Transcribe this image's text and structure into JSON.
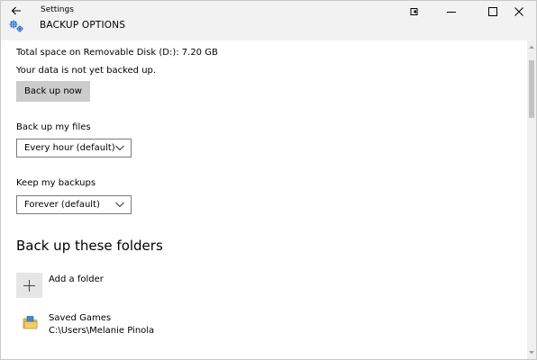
{
  "titlebar": {
    "app_title": "Settings",
    "page_heading": "BACKUP OPTIONS"
  },
  "overview": {
    "total_space": "Total space on Removable Disk (D:): 7.20 GB",
    "status": "Your data is not yet backed up.",
    "backup_now_label": "Back up now"
  },
  "backup_frequency": {
    "label": "Back up my files",
    "selected": "Every hour (default)"
  },
  "keep_backups": {
    "label": "Keep my backups",
    "selected": "Forever (default)"
  },
  "folders": {
    "heading": "Back up these folders",
    "add_label": "Add a folder",
    "items": [
      {
        "name": "Saved Games",
        "path": "C:\\Users\\Melanie Pinola"
      }
    ]
  },
  "colors": {
    "titlebar_bg": "#f2f2f2",
    "button_bg": "#cccccc",
    "accent_blue": "#1f6fcf"
  },
  "icons": {
    "back": "arrow-left-icon",
    "settings": "gear-icon",
    "snap": "snap-icon",
    "minimize": "minimize-icon",
    "maximize": "maximize-icon",
    "close": "close-icon",
    "add": "plus-icon",
    "folder": "folder-icon",
    "dropdown": "chevron-down-icon"
  }
}
